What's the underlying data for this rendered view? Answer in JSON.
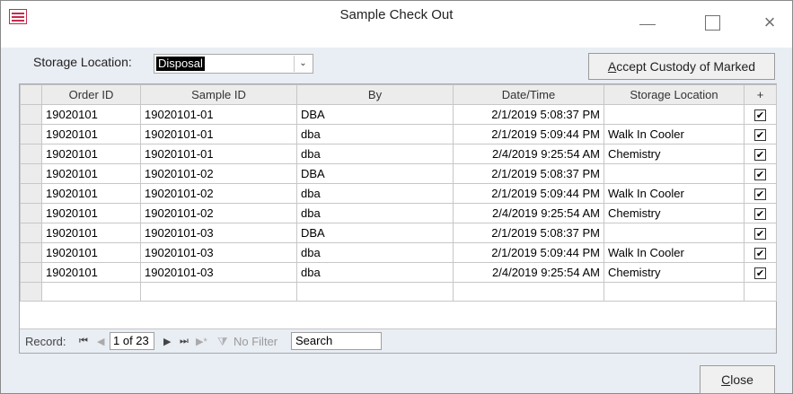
{
  "window": {
    "title": "Sample Check Out",
    "close_glyph": "×"
  },
  "filter": {
    "label": "Storage Location:",
    "value": "Disposal",
    "arrow": "⌄"
  },
  "actions": {
    "accept_label_first": "A",
    "accept_label_rest": "ccept Custody of Marked",
    "close_label_first": "C",
    "close_label_rest": "lose"
  },
  "table": {
    "columns": [
      "Order ID",
      "Sample ID",
      "By",
      "Date/Time",
      "Storage Location",
      "+"
    ],
    "rows": [
      {
        "order_id": "19020101",
        "sample_id": "19020101-01",
        "by": "DBA",
        "datetime": "2/1/2019 5:08:37 PM",
        "location": "",
        "checked": "✔"
      },
      {
        "order_id": "19020101",
        "sample_id": "19020101-01",
        "by": "dba",
        "datetime": "2/1/2019 5:09:44 PM",
        "location": "Walk In Cooler",
        "checked": "✔"
      },
      {
        "order_id": "19020101",
        "sample_id": "19020101-01",
        "by": "dba",
        "datetime": "2/4/2019 9:25:54 AM",
        "location": "Chemistry",
        "checked": "✔"
      },
      {
        "order_id": "19020101",
        "sample_id": "19020101-02",
        "by": "DBA",
        "datetime": "2/1/2019 5:08:37 PM",
        "location": "",
        "checked": "✔"
      },
      {
        "order_id": "19020101",
        "sample_id": "19020101-02",
        "by": "dba",
        "datetime": "2/1/2019 5:09:44 PM",
        "location": "Walk In Cooler",
        "checked": "✔"
      },
      {
        "order_id": "19020101",
        "sample_id": "19020101-02",
        "by": "dba",
        "datetime": "2/4/2019 9:25:54 AM",
        "location": "Chemistry",
        "checked": "✔"
      },
      {
        "order_id": "19020101",
        "sample_id": "19020101-03",
        "by": "DBA",
        "datetime": "2/1/2019 5:08:37 PM",
        "location": "",
        "checked": "✔"
      },
      {
        "order_id": "19020101",
        "sample_id": "19020101-03",
        "by": "dba",
        "datetime": "2/1/2019 5:09:44 PM",
        "location": "Walk In Cooler",
        "checked": "✔"
      },
      {
        "order_id": "19020101",
        "sample_id": "19020101-03",
        "by": "dba",
        "datetime": "2/4/2019 9:25:54 AM",
        "location": "Chemistry",
        "checked": "✔"
      }
    ]
  },
  "navigation": {
    "record_label": "Record:",
    "first_glyph": "⏮",
    "prev_glyph": "◀",
    "position": "1 of 23",
    "next_glyph": "▶",
    "last_glyph": "⏭",
    "new_glyph": "▶*",
    "filter_icon": "⧩",
    "filter_label": "No Filter",
    "search_placeholder": "Search"
  }
}
